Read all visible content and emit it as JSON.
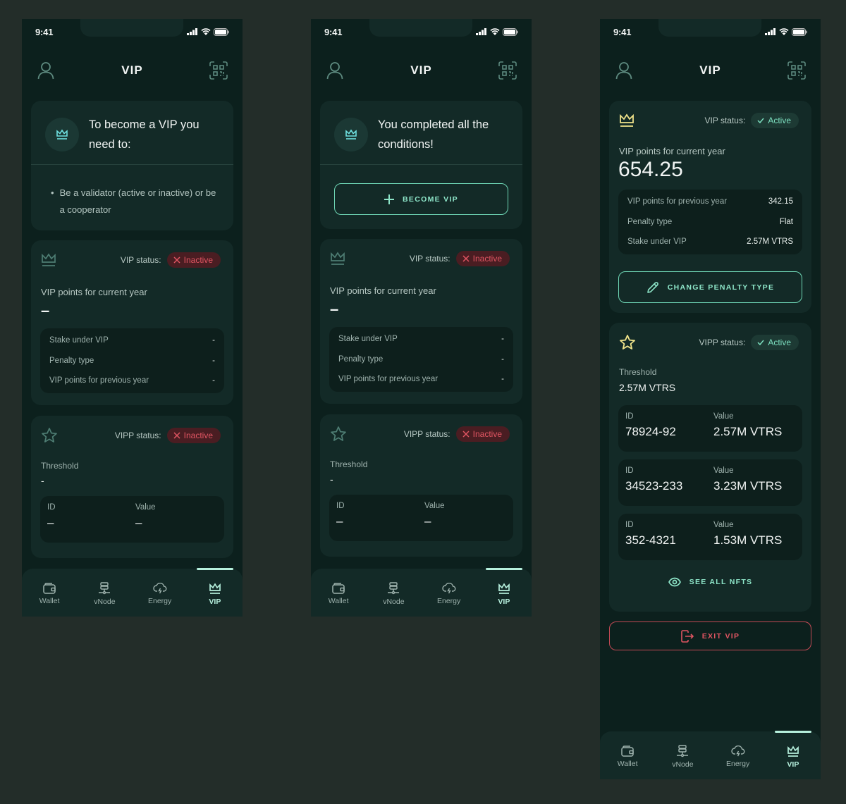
{
  "common": {
    "time": "9:41",
    "title": "VIP",
    "vip_status_label": "VIP status:",
    "vipp_status_label": "VIPP status:",
    "points_current_label": "VIP points for current year",
    "threshold_label": "Threshold",
    "id_label": "ID",
    "value_label": "Value",
    "icons": {
      "profile": "user-icon",
      "scan": "qr-scan-icon",
      "crown": "crown-icon",
      "star": "star-icon"
    },
    "tabs": [
      {
        "label": "Wallet",
        "icon": "wallet-icon"
      },
      {
        "label": "vNode",
        "icon": "server-node-icon"
      },
      {
        "label": "Energy",
        "icon": "cloud-lightning-icon"
      },
      {
        "label": "VIP",
        "icon": "crown-icon",
        "active": true
      }
    ],
    "colors": {
      "accent": "#6fd7b6",
      "active_tab": "#b6f0dd",
      "inactive_red": "#e05562",
      "active_green": "#7de0c0",
      "gold": "#f0e38a"
    }
  },
  "screen1": {
    "intro_title": "To become a VIP you need to:",
    "requirement": "Be a validator (active or inactive) or be a cooperator",
    "vip_status": "Inactive",
    "points_current": "–",
    "details": [
      {
        "label": "Stake under VIP",
        "value": "-"
      },
      {
        "label": "Penalty type",
        "value": "-"
      },
      {
        "label": "VIP points for previous year",
        "value": "-"
      }
    ],
    "vipp_status": "Inactive",
    "threshold": "-",
    "nfts": [
      {
        "id": "–",
        "value": "–"
      }
    ]
  },
  "screen2": {
    "intro_title": "You completed all the conditions!",
    "become_vip_button": "BECOME VIP",
    "vip_status": "Inactive",
    "points_current": "–",
    "details": [
      {
        "label": "Stake under VIP",
        "value": "-"
      },
      {
        "label": "Penalty type",
        "value": "-"
      },
      {
        "label": "VIP points for previous year",
        "value": "-"
      }
    ],
    "vipp_status": "Inactive",
    "threshold": "-",
    "nfts": [
      {
        "id": "–",
        "value": "–"
      }
    ]
  },
  "screen3": {
    "vip_status": "Active",
    "points_current": "654.25",
    "details": [
      {
        "label": "VIP points for previous year",
        "value": "342.15"
      },
      {
        "label": "Penalty type",
        "value": "Flat"
      },
      {
        "label": "Stake under VIP",
        "value": "2.57M VTRS"
      }
    ],
    "change_penalty_button": "CHANGE PENALTY TYPE",
    "vipp_status": "Active",
    "threshold": "2.57M VTRS",
    "nfts": [
      {
        "id": "78924-92",
        "value": "2.57M VTRS"
      },
      {
        "id": "34523-233",
        "value": "3.23M VTRS"
      },
      {
        "id": "352-4321",
        "value": "1.53M VTRS"
      }
    ],
    "see_all_button": "SEE ALL NFTS",
    "exit_button": "EXIT VIP"
  }
}
